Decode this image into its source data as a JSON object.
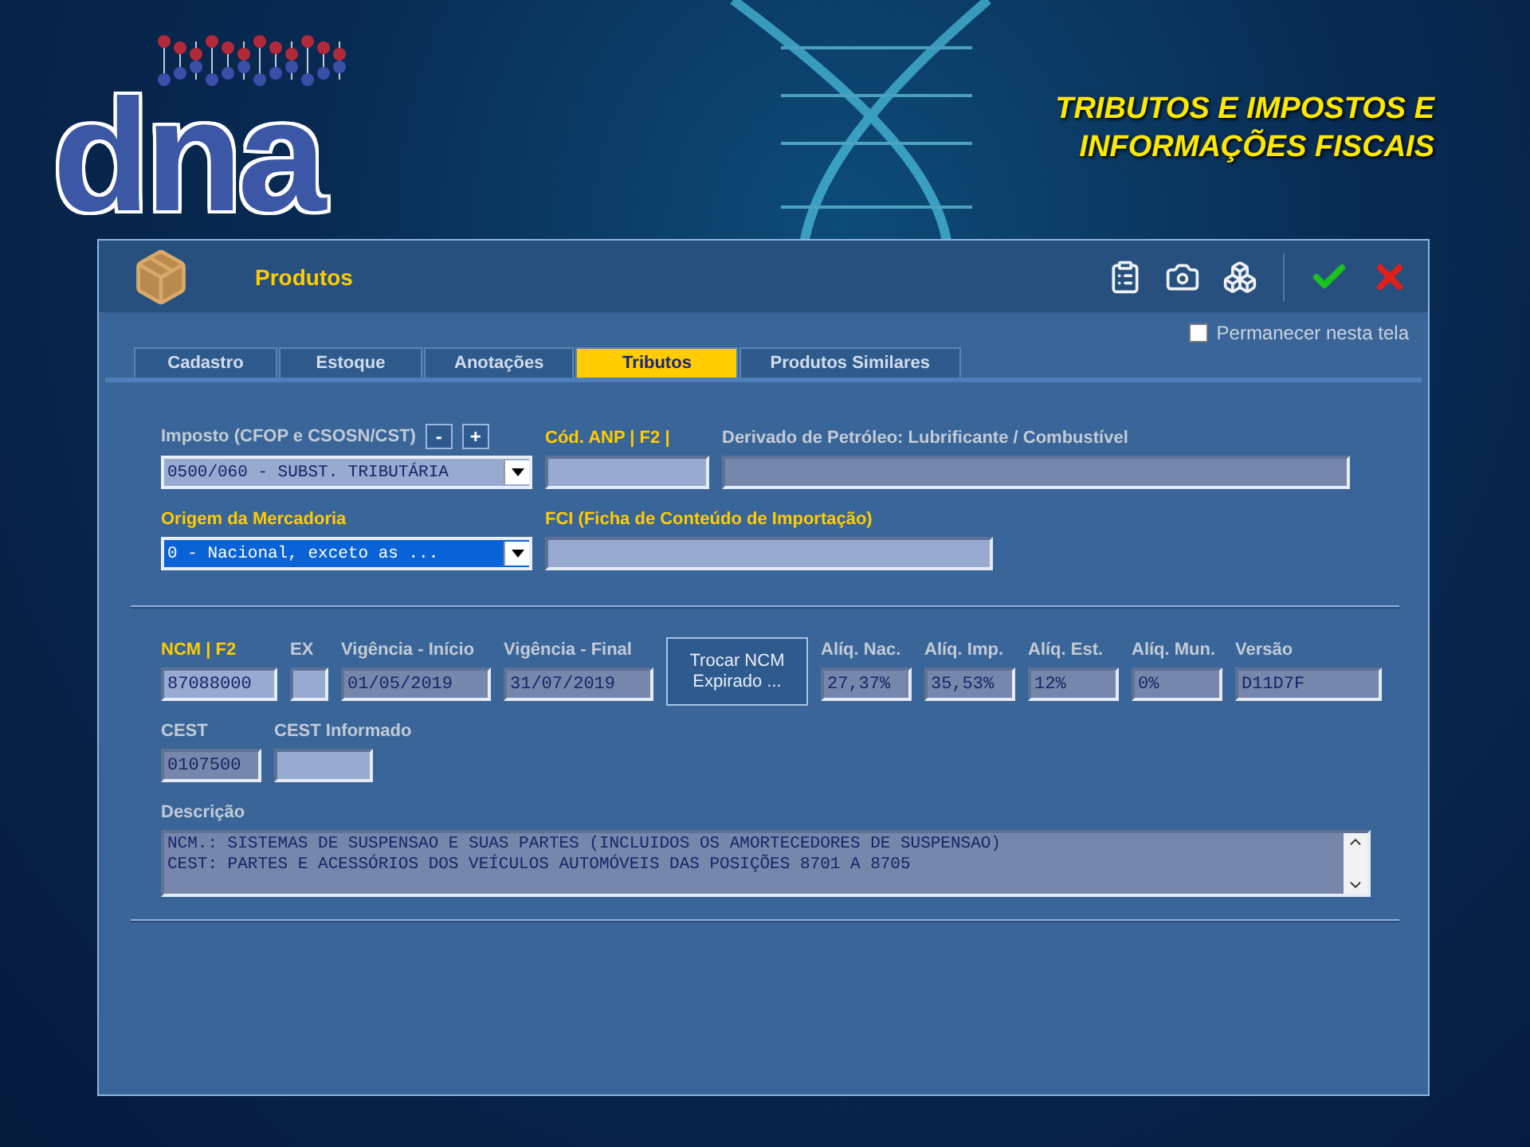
{
  "brand": {
    "logo_text": "dna"
  },
  "headline": [
    "TRIBUTOS E IMPOSTOS E",
    "INFORMAÇÕES FISCAIS"
  ],
  "window": {
    "title": "Produtos",
    "stay_on_screen": {
      "label": "Permanecer nesta tela",
      "checked": false
    }
  },
  "tabs": [
    {
      "label": "Cadastro",
      "selected": false
    },
    {
      "label": "Estoque",
      "selected": false
    },
    {
      "label": "Anotações",
      "selected": false
    },
    {
      "label": "Tributos",
      "selected": true
    },
    {
      "label": "Produtos Similares",
      "selected": false
    }
  ],
  "tax_section": [
    [
      {
        "kind": "select",
        "label": "Imposto (CFOP e CSOSN/CST)",
        "value": "0500/060 - SUBST. TRIBUTÁRIA",
        "required": false,
        "focused": false,
        "buttons": [
          "-",
          "+"
        ]
      },
      {
        "kind": "text",
        "label": "Cód. ANP | F2 |",
        "required": true,
        "readonly": false
      },
      {
        "kind": "text",
        "label": "Derivado de Petróleo: Lubrificante / Combustível",
        "required": false,
        "readonly": true
      }
    ],
    [
      {
        "kind": "select",
        "label": "Origem da Mercadoria",
        "value": "0 - Nacional, exceto as ...",
        "required": true,
        "focused": true
      },
      {
        "kind": "text",
        "label": "FCI (Ficha de Conteúdo de Importação)",
        "required": true,
        "readonly": false
      }
    ]
  ],
  "ncm_section": [
    [
      {
        "kind": "text",
        "label": "NCM | F2",
        "value": "87088000",
        "required": true,
        "readonly": false
      },
      {
        "kind": "text",
        "label": "EX",
        "required": false,
        "readonly": false
      },
      {
        "kind": "text",
        "label": "Vigência - Início",
        "value": "01/05/2019",
        "required": false,
        "readonly": true
      },
      {
        "kind": "text",
        "label": "Vigência - Final",
        "value": "31/07/2019",
        "required": false,
        "readonly": true
      },
      {
        "kind": "button",
        "label": "Trocar NCM Expirado ..."
      },
      {
        "kind": "text",
        "label": "Alíq. Nac.",
        "value": "27,37%",
        "required": false,
        "readonly": true
      },
      {
        "kind": "text",
        "label": "Alíq. Imp.",
        "value": "35,53%",
        "required": false,
        "readonly": true
      },
      {
        "kind": "text",
        "label": "Alíq. Est.",
        "value": "12%",
        "required": false,
        "readonly": true
      },
      {
        "kind": "text",
        "label": "Alíq. Mun.",
        "value": "0%",
        "required": false,
        "readonly": true
      },
      {
        "kind": "text",
        "label": "Versão",
        "value": "D11D7F",
        "required": false,
        "readonly": true
      }
    ],
    [
      {
        "kind": "text",
        "label": "CEST",
        "value": "0107500",
        "required": false,
        "readonly": true
      },
      {
        "kind": "text",
        "label": "CEST Informado",
        "required": false,
        "readonly": false
      }
    ],
    [
      {
        "kind": "textarea",
        "label": "Descrição",
        "lines": [
          "NCM.: SISTEMAS DE SUSPENSAO E SUAS PARTES (INCLUIDOS OS AMORTECEDORES DE SUSPENSAO)",
          "CEST: PARTES E ACESSÓRIOS DOS VEÍCULOS AUTOMÓVEIS DAS POSIÇÕES 8701 A 8705"
        ],
        "required": false,
        "readonly": true
      }
    ]
  ]
}
